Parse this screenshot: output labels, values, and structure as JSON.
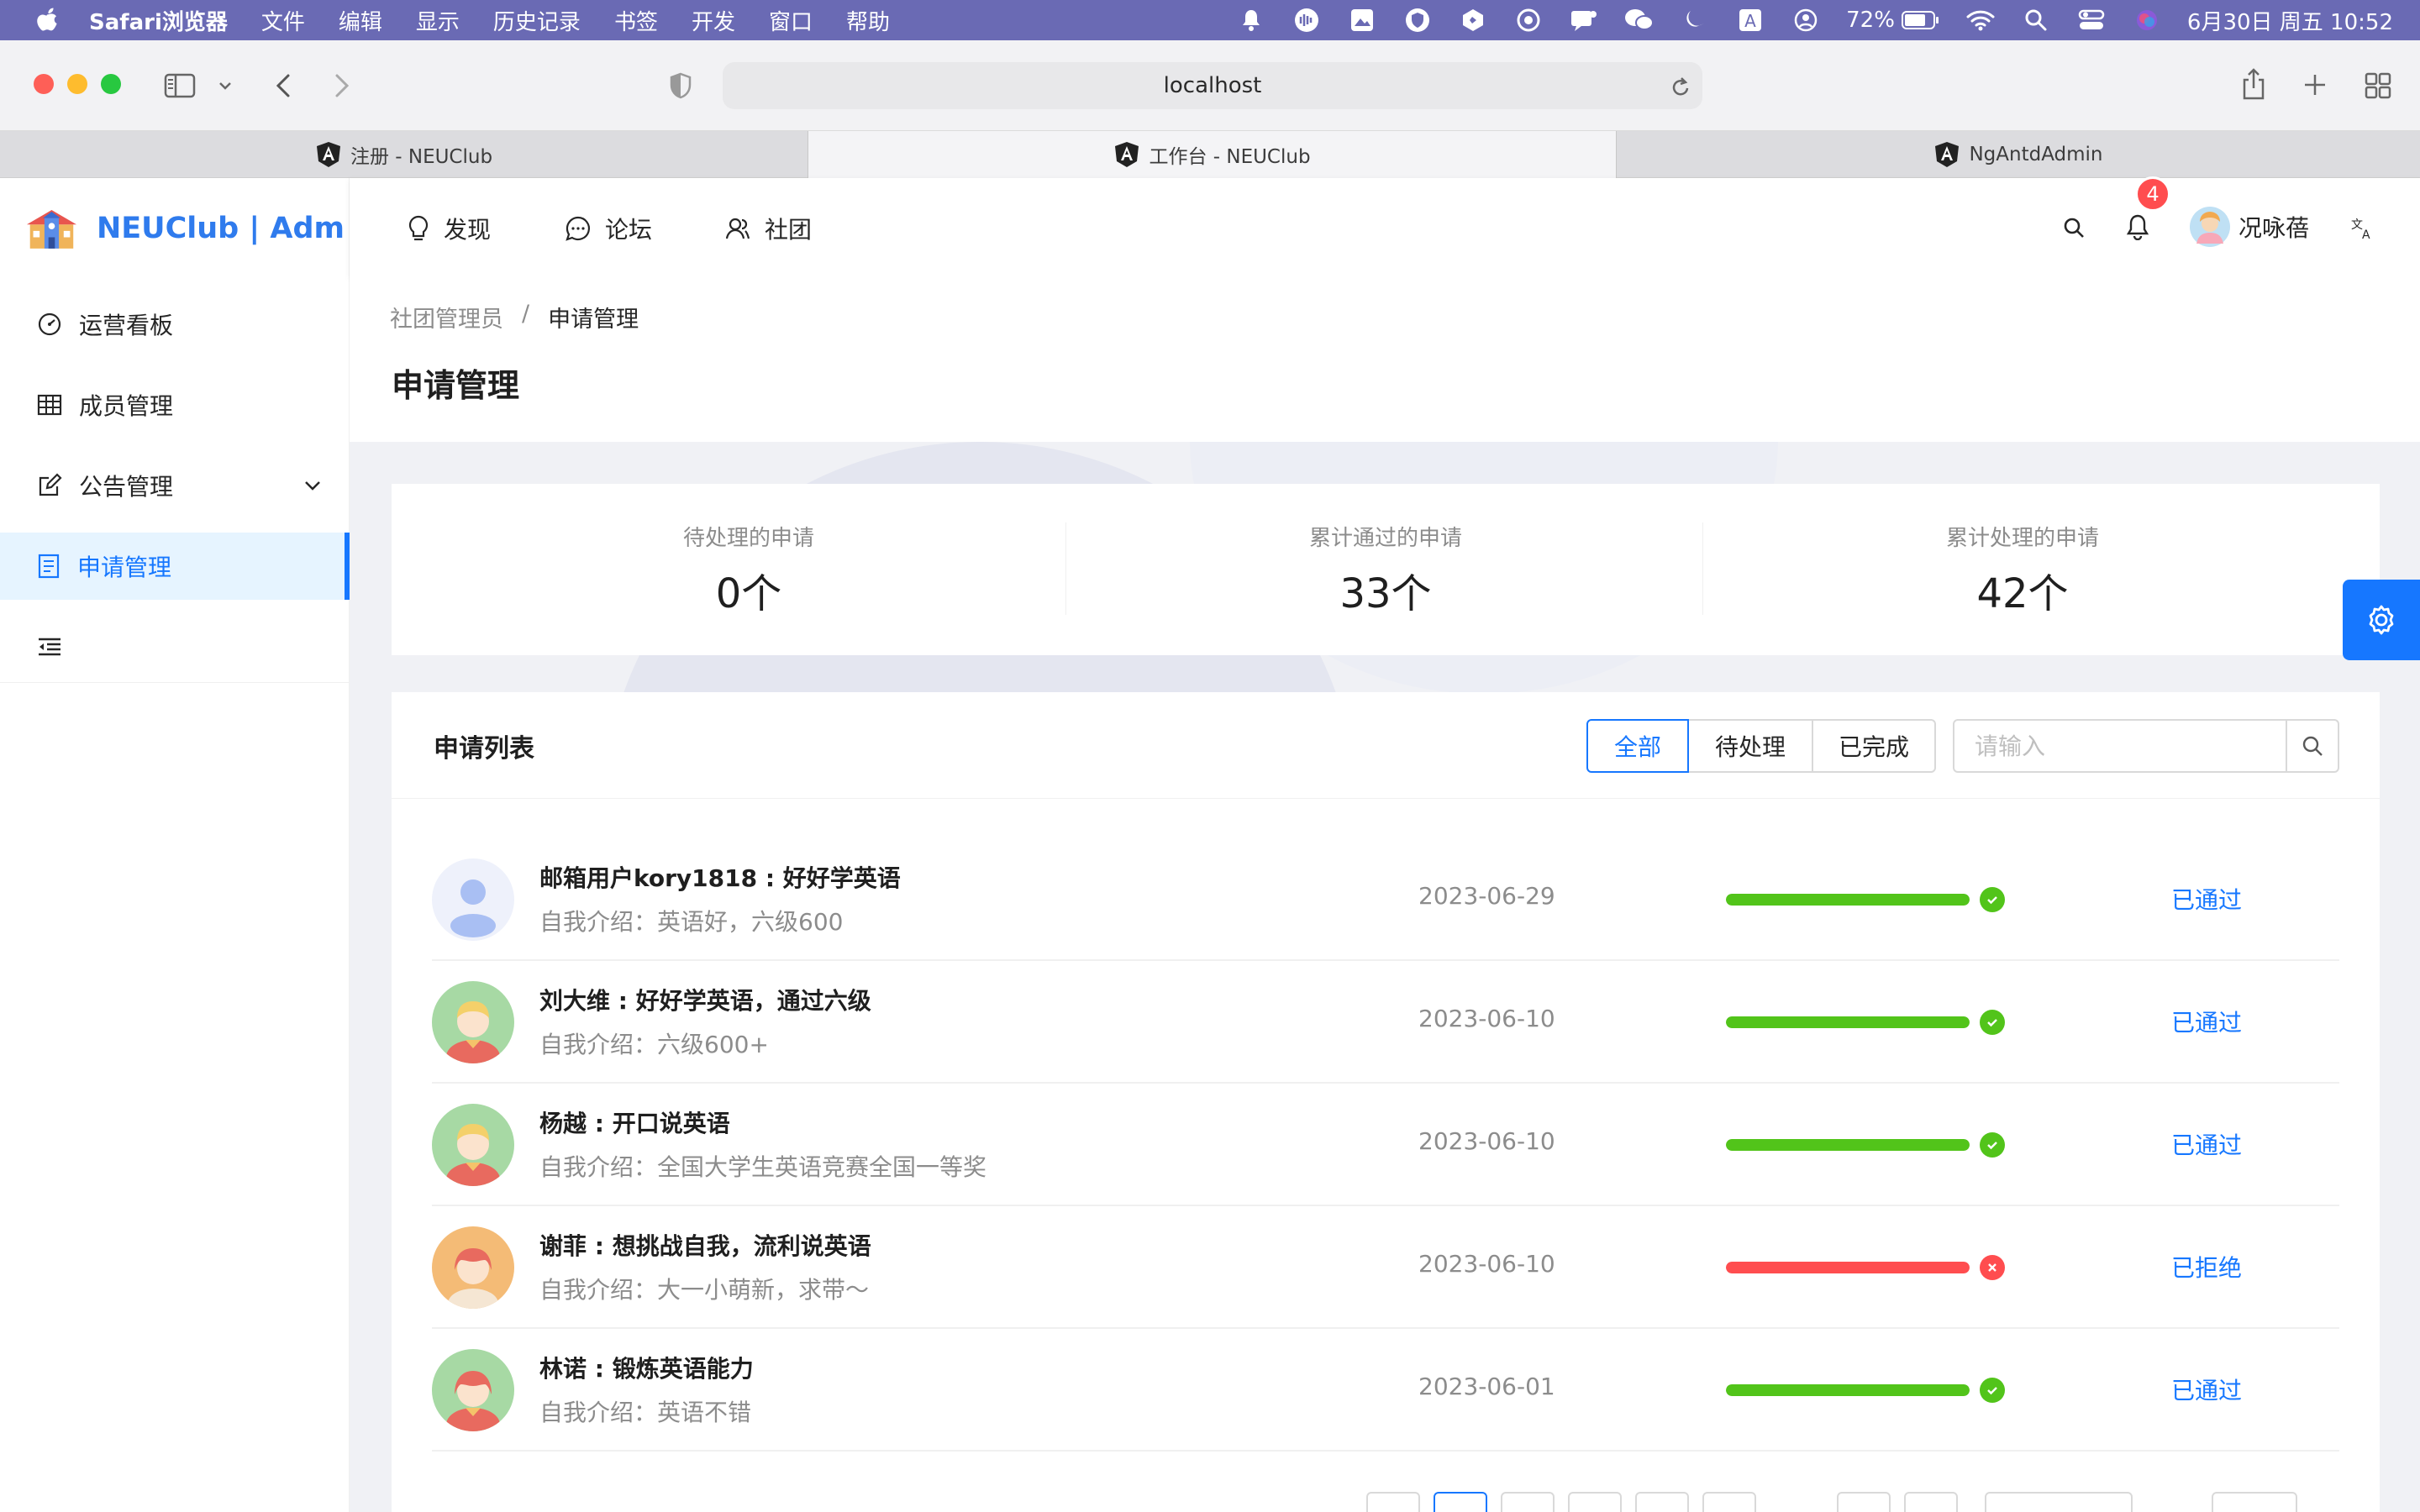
{
  "menubar": {
    "app_name": "Safari浏览器",
    "items": [
      "文件",
      "编辑",
      "显示",
      "历史记录",
      "书签",
      "开发",
      "窗口",
      "帮助"
    ],
    "battery": "72%",
    "datetime": "6月30日 周五 10:52"
  },
  "browser": {
    "url": "localhost",
    "tabs": [
      {
        "label": "注册 - NEUClub"
      },
      {
        "label": "工作台 - NEUClub"
      },
      {
        "label": "NgAntdAdmin"
      }
    ]
  },
  "sidebar": {
    "logo_text": "NEUClub | Adm",
    "items": [
      {
        "label": "运营看板"
      },
      {
        "label": "成员管理"
      },
      {
        "label": "公告管理"
      },
      {
        "label": "申请管理"
      }
    ]
  },
  "header": {
    "nav": [
      {
        "label": "发现"
      },
      {
        "label": "论坛"
      },
      {
        "label": "社团"
      }
    ],
    "notification_count": "4",
    "user_name": "况咏蓓"
  },
  "breadcrumb": {
    "parent": "社团管理员",
    "separator": "/",
    "current": "申请管理"
  },
  "page_title": "申请管理",
  "stats": [
    {
      "label": "待处理的申请",
      "value": "0个"
    },
    {
      "label": "累计通过的申请",
      "value": "33个"
    },
    {
      "label": "累计处理的申请",
      "value": "42个"
    }
  ],
  "list": {
    "title": "申请列表",
    "filters": [
      "全部",
      "待处理",
      "已完成"
    ],
    "active_filter": "全部",
    "search_placeholder": "请输入",
    "rows": [
      {
        "title": "邮箱用户kory1818 : 好好学英语",
        "desc": "自我介绍：英语好，六级600",
        "date": "2023-06-29",
        "progress": 100,
        "result": "passed",
        "status": "已通过"
      },
      {
        "title": "刘大维 : 好好学英语，通过六级",
        "desc": "自我介绍：六级600+",
        "date": "2023-06-10",
        "progress": 100,
        "result": "passed",
        "status": "已通过"
      },
      {
        "title": "杨越 : 开口说英语",
        "desc": "自我介绍：全国大学生英语竞赛全国一等奖",
        "date": "2023-06-10",
        "progress": 100,
        "result": "passed",
        "status": "已通过"
      },
      {
        "title": "谢菲 : 想挑战自我，流利说英语",
        "desc": "自我介绍：大一小萌新，求带～",
        "date": "2023-06-10",
        "progress": 100,
        "result": "rejected",
        "status": "已拒绝"
      },
      {
        "title": "林诺 : 锻炼英语能力",
        "desc": "自我介绍：英语不错",
        "date": "2023-06-01",
        "progress": 100,
        "result": "passed",
        "status": "已通过"
      }
    ]
  },
  "colors": {
    "primary": "#1677ff",
    "success": "#52c41a",
    "error": "#ff4d4f",
    "menubar": "#6a6ab4"
  }
}
